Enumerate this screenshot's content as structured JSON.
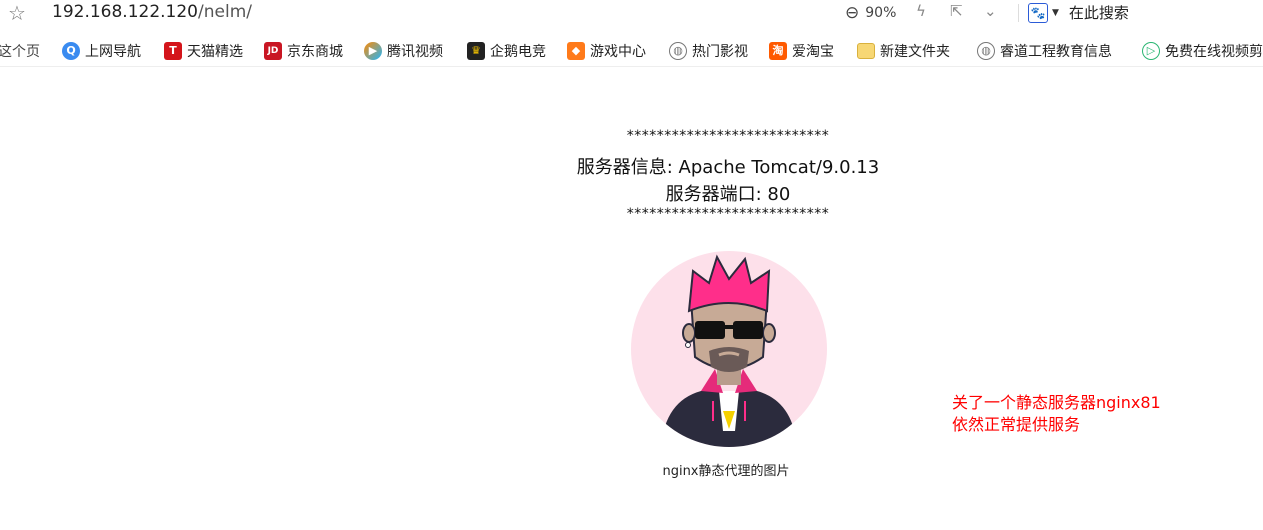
{
  "browser": {
    "url_host": "192.168.122.120",
    "url_path": "/nelm/",
    "zoom": "90%",
    "search_placeholder": "在此搜索"
  },
  "bookmarks": [
    {
      "label": "这个页",
      "icon": "page-icon"
    },
    {
      "label": "上网导航",
      "icon": "nav-icon"
    },
    {
      "label": "天猫精选",
      "icon": "tmall-icon"
    },
    {
      "label": "京东商城",
      "icon": "jd-icon"
    },
    {
      "label": "腾讯视频",
      "icon": "tencent-video-icon"
    },
    {
      "label": "企鹅电竞",
      "icon": "penguin-esports-icon"
    },
    {
      "label": "游戏中心",
      "icon": "game-icon"
    },
    {
      "label": "热门影视",
      "icon": "globe-icon"
    },
    {
      "label": "爱淘宝",
      "icon": "taobao-icon"
    },
    {
      "label": "新建文件夹",
      "icon": "folder-icon"
    },
    {
      "label": "睿道工程教育信息",
      "icon": "globe-icon"
    },
    {
      "label": "免费在线视频剪",
      "icon": "video-edit-icon"
    }
  ],
  "page": {
    "stars_top": "***************************",
    "server_info": "服务器信息: Apache Tomcat/9.0.13",
    "server_port": "服务器端口: 80",
    "stars_bottom": "***************************",
    "image_caption": "nginx静态代理的图片",
    "note_line1": "关了一个静态服务器nginx81",
    "note_line2": "依然正常提供服务"
  },
  "colors": {
    "note": "#ff0000",
    "avatar_bg": "#fde0ea",
    "hair": "#ff2e8a"
  }
}
